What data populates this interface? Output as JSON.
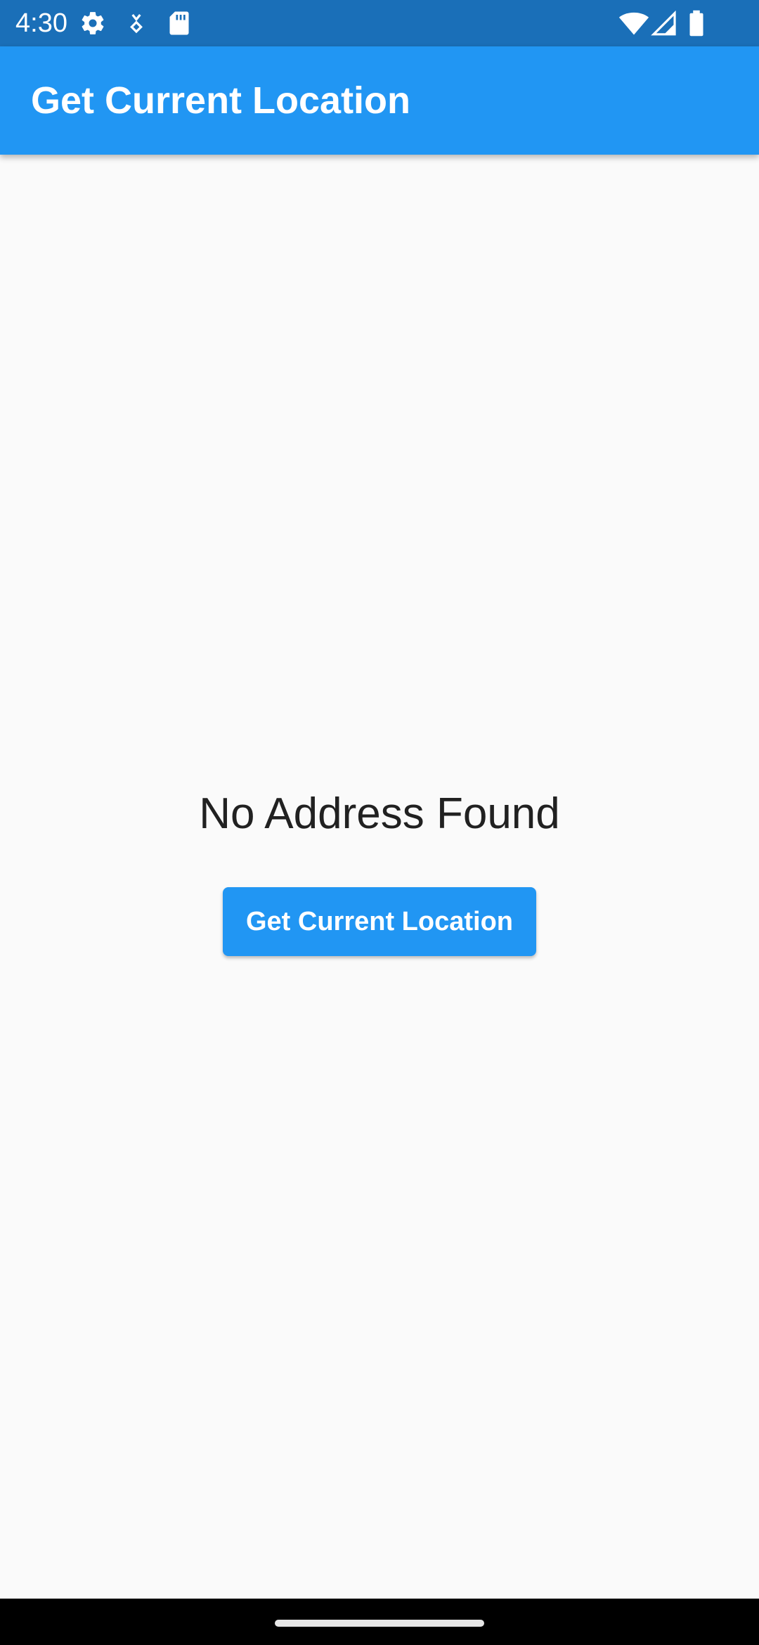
{
  "status_bar": {
    "time": "4:30",
    "icons_left": [
      "settings-gear-icon",
      "download-icon",
      "sd-card-icon"
    ],
    "icons_right": [
      "wifi-icon",
      "cellular-signal-icon",
      "battery-icon"
    ],
    "background_color": "#1a6fb8"
  },
  "app_bar": {
    "title": "Get Current Location",
    "background_color": "#2196f3"
  },
  "main": {
    "address_text": "No Address Found",
    "button_label": "Get Current Location",
    "button_color": "#2196f3"
  },
  "nav_bar": {
    "indicator": "home-gesture-indicator"
  }
}
